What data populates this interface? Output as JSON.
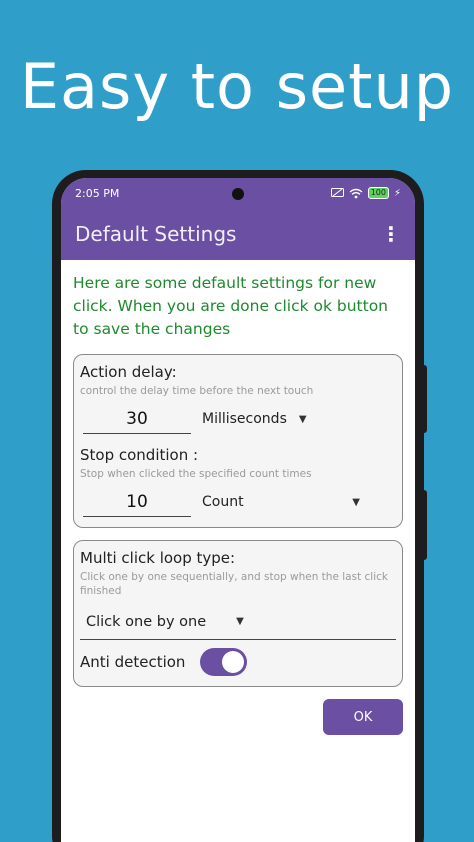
{
  "headline": "Easy to setup",
  "status_bar": {
    "time": "2:05 PM",
    "battery": "100",
    "icons": [
      "screen-share-off-icon",
      "wifi-icon",
      "battery-icon",
      "charging-icon"
    ]
  },
  "app_bar": {
    "title": "Default Settings",
    "menu_icon": "more-vert-icon"
  },
  "intro_text": "Here are some default settings for new click. When you are done click ok button to save the changes",
  "action_delay": {
    "label": "Action delay:",
    "description": "control the delay time before the next touch",
    "value": "30",
    "unit": "Milliseconds"
  },
  "stop_condition": {
    "label": "Stop condition :",
    "description": "Stop when clicked the specified count times",
    "value": "10",
    "unit": "Count"
  },
  "loop_type": {
    "label": "Multi click loop type:",
    "description": "Click one by one sequentially, and stop when the last click finished",
    "selected": "Click one by one"
  },
  "anti_detection": {
    "label": "Anti detection",
    "enabled": true
  },
  "ok_label": "OK",
  "colors": {
    "background": "#2f9fc9",
    "primary": "#6a4fa3",
    "intro_green": "#1e8a2d"
  }
}
